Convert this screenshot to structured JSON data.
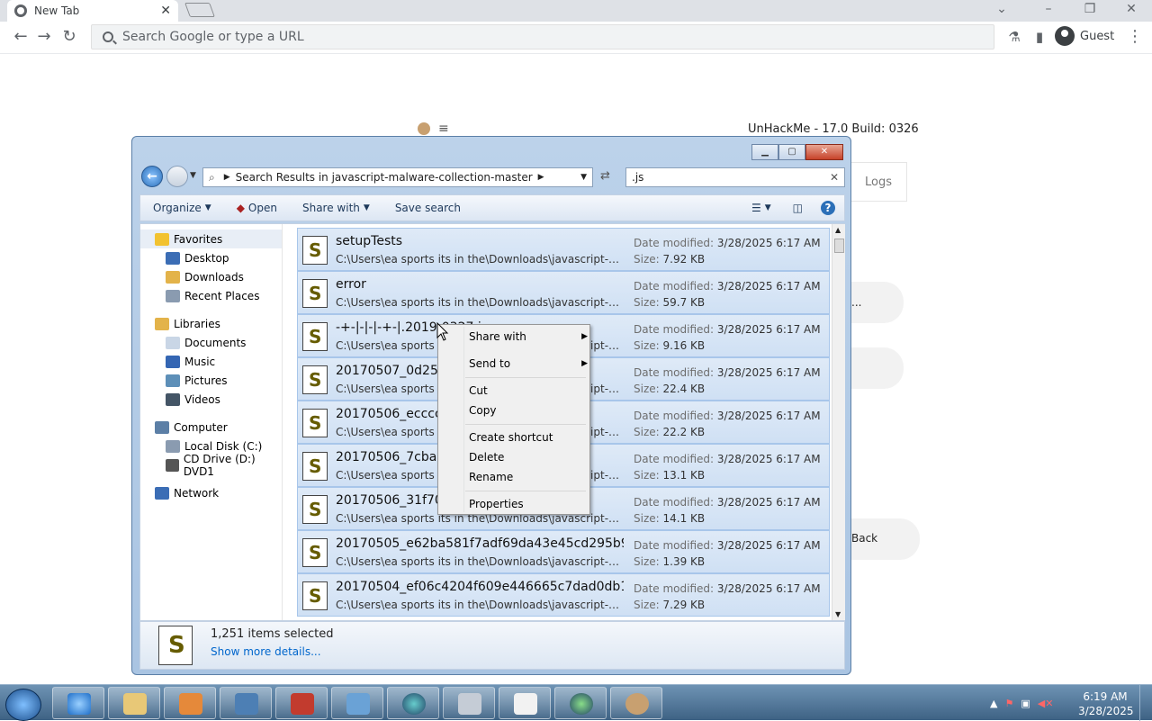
{
  "browser": {
    "tab_title": "New Tab",
    "omnibox_placeholder": "Search Google or type a URL",
    "profile_label": "Guest"
  },
  "unhackme": {
    "title": "UnHackMe - 17.0 Build: 0326",
    "logs_tab": "Logs",
    "pill1_text": "...",
    "back_label": "Back"
  },
  "explorer": {
    "address": "Search Results in javascript-malware-collection-master",
    "search_value": ".js",
    "commands": {
      "organize": "Organize",
      "open": "Open",
      "share_with": "Share with",
      "save_search": "Save search"
    },
    "nav": [
      {
        "label": "Favorites",
        "group": true,
        "color": "#f2c230"
      },
      {
        "label": "Desktop",
        "group": false,
        "color": "#3b6db5"
      },
      {
        "label": "Downloads",
        "group": false,
        "color": "#e3b34a"
      },
      {
        "label": "Recent Places",
        "group": false,
        "color": "#8a9bb0"
      },
      {
        "label": "Libraries",
        "group": true,
        "color": "#e3b34a"
      },
      {
        "label": "Documents",
        "group": false,
        "color": "#c9d6e6"
      },
      {
        "label": "Music",
        "group": false,
        "color": "#3466b3"
      },
      {
        "label": "Pictures",
        "group": false,
        "color": "#5d8fb8"
      },
      {
        "label": "Videos",
        "group": false,
        "color": "#445566"
      },
      {
        "label": "Computer",
        "group": true,
        "color": "#5c7fa6"
      },
      {
        "label": "Local Disk (C:)",
        "group": false,
        "color": "#8a9bb0"
      },
      {
        "label": "CD Drive (D:) DVD1",
        "group": false,
        "color": "#555"
      },
      {
        "label": "Network",
        "group": true,
        "color": "#3b6db5"
      }
    ],
    "date_label": "Date modified:",
    "size_label": "Size:",
    "files": [
      {
        "name": "setupTests",
        "path": "C:\\Users\\ea sports its in the\\Downloads\\javascript-malwar...",
        "date": "3/28/2025 6:17 AM",
        "size": "7.92 KB"
      },
      {
        "name": "error",
        "path": "C:\\Users\\ea sports its in the\\Downloads\\javascript-malwar...",
        "date": "3/28/2025 6:17 AM",
        "size": "59.7 KB"
      },
      {
        "name": "-+-|-|-|-+-|.2019-0327.js",
        "path": "C:\\Users\\ea sports its in the\\Downloads\\javascript-malwar...",
        "date": "3/28/2025 6:17 AM",
        "size": "9.16 KB"
      },
      {
        "name": "20170507_0d2589                    508...",
        "path": "C:\\Users\\ea sports its in the\\Downloads\\javascript-malwar...",
        "date": "3/28/2025 6:17 AM",
        "size": "22.4 KB"
      },
      {
        "name": "20170506_ecccca                    5103",
        "path": "C:\\Users\\ea sports its in the\\Downloads\\javascript-malwar...",
        "date": "3/28/2025 6:17 AM",
        "size": "22.2 KB"
      },
      {
        "name": "20170506_7cba0a                    58c...",
        "path": "C:\\Users\\ea sports its in the\\Downloads\\javascript-malwar...",
        "date": "3/28/2025 6:17 AM",
        "size": "13.1 KB"
      },
      {
        "name": "20170506_31f706                    2e8...",
        "path": "C:\\Users\\ea sports its in the\\Downloads\\javascript-malwar...",
        "date": "3/28/2025 6:17 AM",
        "size": "14.1 KB"
      },
      {
        "name": "20170505_e62ba581f7adf69da43e45cd295b9c...",
        "path": "C:\\Users\\ea sports its in the\\Downloads\\javascript-malwar...",
        "date": "3/28/2025 6:17 AM",
        "size": "1.39 KB"
      },
      {
        "name": "20170504_ef06c4204f609e446665c7dad0db15...",
        "path": "C:\\Users\\ea sports its in the\\Downloads\\javascript-malwar...",
        "date": "3/28/2025 6:17 AM",
        "size": "7.29 KB"
      }
    ],
    "selection_count": "1,251 items selected",
    "show_more": "Show more details..."
  },
  "context_menu": {
    "share_with": "Share with",
    "send_to": "Send to",
    "cut": "Cut",
    "copy": "Copy",
    "create_shortcut": "Create shortcut",
    "delete": "Delete",
    "rename": "Rename",
    "properties": "Properties"
  },
  "taskbar": {
    "time": "6:19 AM",
    "date": "3/28/2025"
  }
}
